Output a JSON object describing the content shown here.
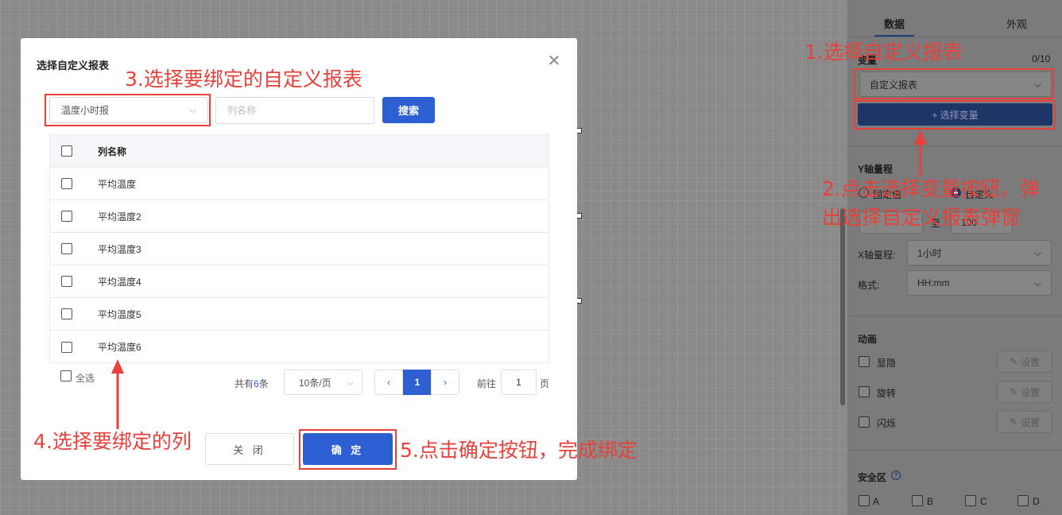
{
  "right_panel": {
    "tabs": [
      "数据",
      "外观"
    ],
    "variable_label": "变量",
    "variable_count": "0/10",
    "variable_select": "自定义报表",
    "select_variable_button": "+ 选择变量",
    "y_range_title": "Y轴量程",
    "y_range_options": [
      "固定值",
      "自定义"
    ],
    "to_label": "至",
    "y_to_value": "100",
    "x_range_label": "X轴量程:",
    "x_range_value": "1小时",
    "format_label": "格式:",
    "format_value": "HH:mm",
    "animation_title": "动画",
    "animations": [
      "显隐",
      "旋转",
      "闪烁"
    ],
    "set_label": "设置",
    "safe_zone_title": "安全区",
    "safe_zones": [
      "A",
      "B",
      "C",
      "D"
    ]
  },
  "modal": {
    "title": "选择自定义报表",
    "report_select": "温度小时报",
    "search_placeholder": "列名称",
    "search_button": "搜索",
    "table_header": "列名称",
    "rows": [
      "平均温度",
      "平均温度2",
      "平均温度3",
      "平均温度4",
      "平均温度5",
      "平均温度6"
    ],
    "select_all": "全选",
    "total_prefix": "共有",
    "total_count": "6",
    "total_suffix": "条",
    "page_size": "10条/页",
    "current_page": "1",
    "goto_label": "前往",
    "goto_value": "1",
    "page_unit": "页",
    "close_button": "关 闭",
    "confirm_button": "确 定"
  },
  "annotations": {
    "step1": "1.选择自定义报表",
    "step2_line1": "2.点击选择变量按钮，弹",
    "step2_line2": "出选择自定义报表弹窗",
    "step3": "3.选择要绑定的自定义报表",
    "step4": "4.选择要绑定的列",
    "step5": "5.点击确定按钮，完成绑定"
  },
  "colors": {
    "primary": "#2d5fd3",
    "annotation": "#e8413b",
    "dark_button": "#1e3568"
  }
}
